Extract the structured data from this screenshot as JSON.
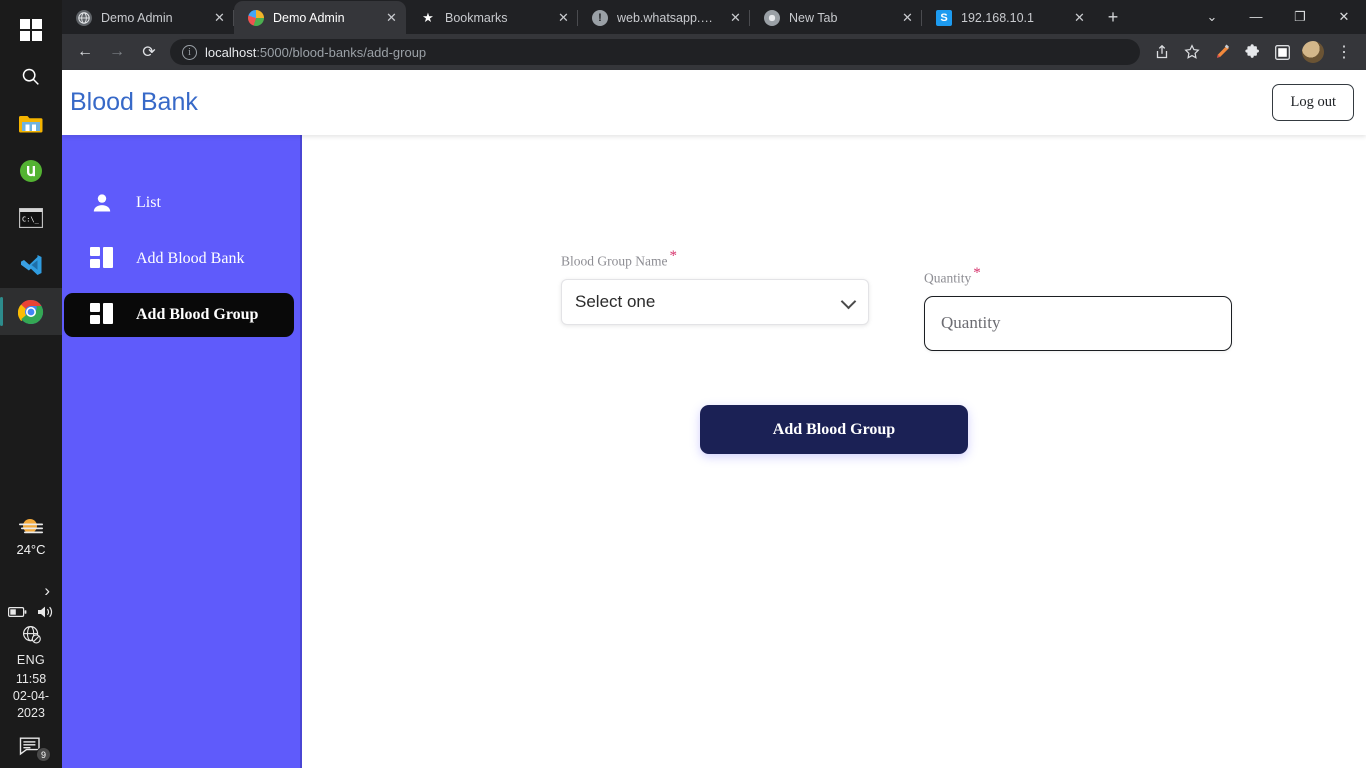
{
  "os": {
    "taskbar_icons": [
      {
        "name": "windows-start-icon",
        "label": "Start"
      },
      {
        "name": "search-icon",
        "label": "Search"
      },
      {
        "name": "file-explorer-icon",
        "label": "File Explorer"
      },
      {
        "name": "utorrent-icon",
        "label": "uTorrent"
      },
      {
        "name": "terminal-icon",
        "label": "Command Prompt"
      },
      {
        "name": "vscode-icon",
        "label": "Visual Studio Code"
      },
      {
        "name": "chrome-icon",
        "label": "Google Chrome"
      }
    ],
    "tray": {
      "temperature": "24°C",
      "language": "ENG",
      "time": "11:58",
      "date": "02-04-2023",
      "notification_count": "9",
      "chevron": "›"
    }
  },
  "browser": {
    "tabs": [
      {
        "title": "Demo Admin",
        "favicon": "globe-icon",
        "active": false
      },
      {
        "title": "Demo Admin",
        "favicon": "earth-icon",
        "active": true
      },
      {
        "title": "Bookmarks",
        "favicon": "star-icon",
        "active": false
      },
      {
        "title": "web.whatsapp.com",
        "favicon": "warning-icon",
        "active": false
      },
      {
        "title": "New Tab",
        "favicon": "chrome-icon",
        "active": false
      },
      {
        "title": "192.168.10.1",
        "favicon": "s-icon",
        "active": false
      }
    ],
    "close_glyph": "✕",
    "new_tab_glyph": "+",
    "window_controls": {
      "list": "⌄",
      "minimize": "—",
      "maximize": "❐",
      "close": "✕"
    },
    "nav": {
      "back": "←",
      "forward": "→",
      "reload": "⟳"
    },
    "omnibox": {
      "host": "localhost",
      "path": ":5000/blood-banks/add-group",
      "full_url": "localhost:5000/blood-banks/add-group",
      "security_glyph": "i"
    },
    "toolbar_right": [
      {
        "name": "share-icon",
        "glyph": "⇪"
      },
      {
        "name": "bookmark-star-icon",
        "glyph": "☆"
      },
      {
        "name": "pen-extension-icon",
        "glyph": "✎"
      },
      {
        "name": "extensions-puzzle-icon",
        "glyph": "🧩"
      },
      {
        "name": "sidepanel-icon",
        "glyph": "▫"
      },
      {
        "name": "profile-avatar",
        "glyph": ""
      },
      {
        "name": "chrome-menu-icon",
        "glyph": "⋮"
      }
    ]
  },
  "app": {
    "brand": "Blood Bank",
    "logout_label": "Log out",
    "accent_color": "#5f5bfb",
    "brand_color": "#3769c8",
    "active_item_color": "#090909",
    "submit_color": "#1b2155",
    "sidebar": {
      "items": [
        {
          "label": "List",
          "icon": "person-icon",
          "active": false
        },
        {
          "label": "Add Blood Bank",
          "icon": "grid-icon",
          "active": false
        },
        {
          "label": "Add Blood Group",
          "icon": "grid-icon",
          "active": true
        }
      ]
    },
    "form": {
      "blood_group": {
        "label": "Blood Group Name",
        "required_marker": "*",
        "selected": "Select one",
        "options": [
          "Select one"
        ]
      },
      "quantity": {
        "label": "Quantity",
        "required_marker": "*",
        "value": "",
        "placeholder": "Quantity"
      },
      "submit_label": "Add Blood Group"
    }
  }
}
